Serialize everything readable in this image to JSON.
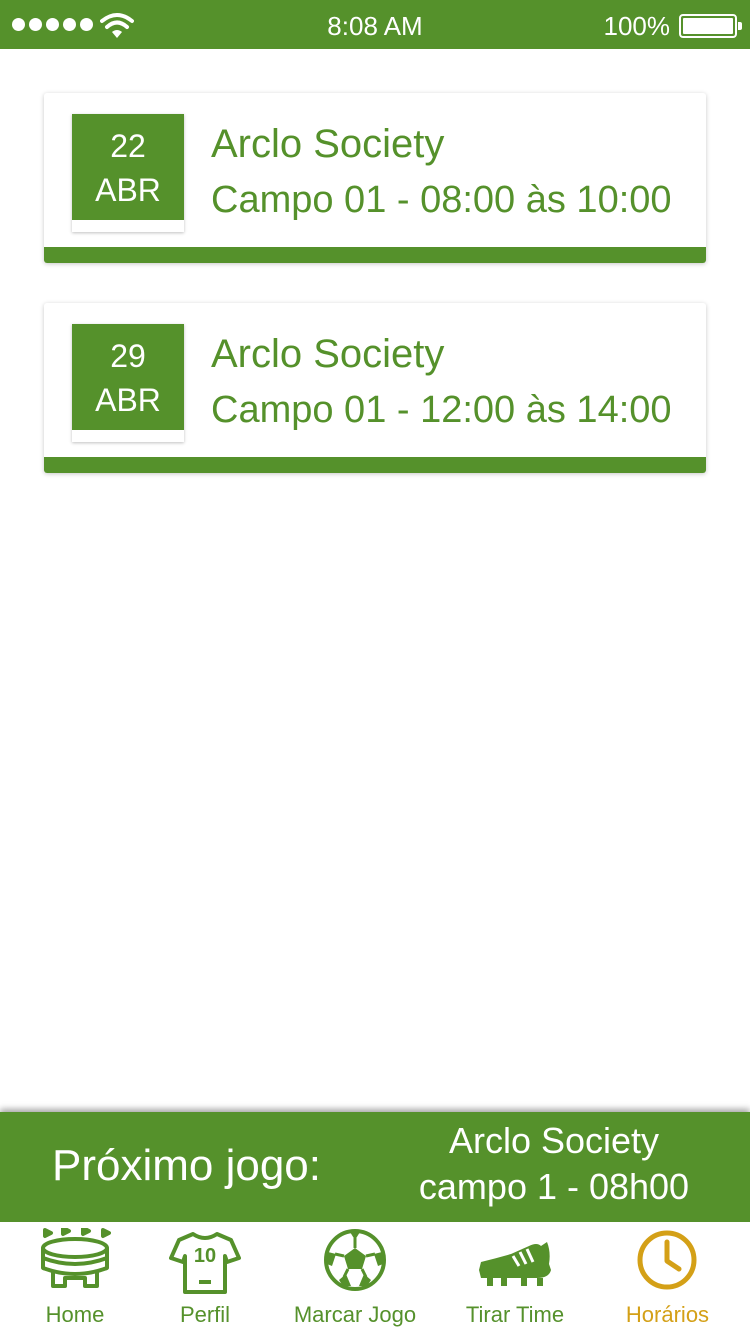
{
  "status_bar": {
    "time": "8:08 AM",
    "battery": "100%",
    "signal_dots": 5
  },
  "bookings": [
    {
      "day": "22",
      "month": "ABR",
      "venue": "Arclo Society",
      "slot": "Campo 01 - 08:00 às 10:00"
    },
    {
      "day": "29",
      "month": "ABR",
      "venue": "Arclo Society",
      "slot": "Campo 01 - 12:00 às 14:00"
    }
  ],
  "next_game": {
    "label": "Próximo jogo:",
    "venue": "Arclo Society",
    "field": "campo 1 - 08h00"
  },
  "tabs": [
    {
      "label": "Home",
      "icon": "stadium-icon"
    },
    {
      "label": "Perfil",
      "icon": "jersey-icon"
    },
    {
      "label": "Marcar Jogo",
      "icon": "soccer-ball-icon"
    },
    {
      "label": "Tirar Time",
      "icon": "cleat-icon"
    },
    {
      "label": "Horários",
      "icon": "clock-icon",
      "active": true
    }
  ],
  "colors": {
    "primary": "#55912b",
    "active_tab": "#d4a017",
    "background": "#ffffff"
  }
}
